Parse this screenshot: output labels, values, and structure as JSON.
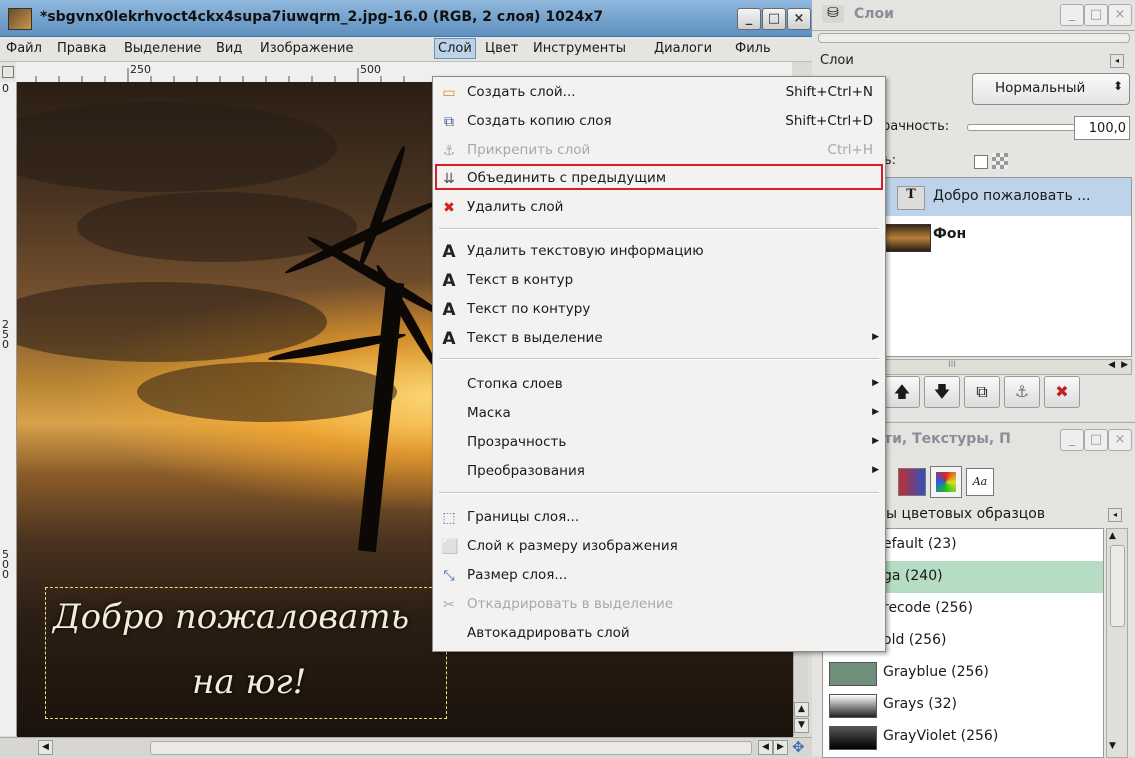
{
  "window": {
    "title": "*sbgvnx0lekrhvoct4ckx4supa7iuwqrm_2.jpg-16.0 (RGB, 2 слоя) 1024x7",
    "min": "_",
    "max": "□",
    "close": "×"
  },
  "menubar": [
    "Файл",
    "Правка",
    "Выделение",
    "Вид",
    "Изображение",
    "Слой",
    "Цвет",
    "Инструменты",
    "Диалоги",
    "Филь"
  ],
  "ruler": {
    "h": [
      "250",
      "500"
    ],
    "v": [
      "0",
      "250",
      "500"
    ]
  },
  "canvas_text": {
    "line1": "Добро пожаловать",
    "line2": "на юг!"
  },
  "layer_menu": {
    "items": [
      {
        "label": "Создать слой...",
        "shortcut": "Shift+Ctrl+N",
        "icon": "new-layer-icon",
        "glyph": "▭"
      },
      {
        "label": "Создать копию слоя",
        "shortcut": "Shift+Ctrl+D",
        "icon": "duplicate-layer-icon",
        "glyph": "⧉"
      },
      {
        "label": "Прикрепить слой",
        "shortcut": "Ctrl+H",
        "icon": "anchor-icon",
        "glyph": "⚓",
        "disabled": true
      },
      {
        "label": "Объединить с предыдущим",
        "shortcut": "",
        "icon": "merge-down-icon",
        "glyph": "⇊"
      },
      {
        "label": "Удалить слой",
        "shortcut": "",
        "icon": "delete-layer-icon",
        "glyph": "✖"
      },
      {
        "label": "Удалить текстовую информацию",
        "icon": "text-icon",
        "glyph": "A"
      },
      {
        "label": "Текст в контур",
        "icon": "text-icon",
        "glyph": "A"
      },
      {
        "label": "Текст по контуру",
        "icon": "text-icon",
        "glyph": "A"
      },
      {
        "label": "Текст в выделение",
        "icon": "text-icon",
        "glyph": "A",
        "submenu": true
      },
      {
        "label": "Стопка слоев",
        "submenu": true
      },
      {
        "label": "Маска",
        "submenu": true
      },
      {
        "label": "Прозрачность",
        "submenu": true
      },
      {
        "label": "Преобразования",
        "submenu": true
      },
      {
        "label": "Границы слоя...",
        "icon": "layer-boundary-icon",
        "glyph": "⬚"
      },
      {
        "label": "Слой к размеру изображения",
        "icon": "layer-to-image-size-icon",
        "glyph": "⬜"
      },
      {
        "label": "Размер слоя...",
        "icon": "scale-layer-icon",
        "glyph": "⤡"
      },
      {
        "label": "Откадрировать в выделение",
        "icon": "crop-icon",
        "glyph": "✂",
        "disabled": true
      },
      {
        "label": "Автокадрировать слой",
        "icon": "",
        "glyph": ""
      }
    ]
  },
  "layers_panel": {
    "title": "Слои",
    "tab_label": "Слои",
    "mode": "Нормальный",
    "opacity_label": "рачность:",
    "opacity_value": "100,0",
    "lock_label": "ь:",
    "layers": [
      {
        "name": "Добро пожаловать ...",
        "type": "text"
      },
      {
        "name": "Фон",
        "type": "image"
      }
    ],
    "scroll_mid": "III"
  },
  "palettes_panel": {
    "title": "ти, Текстуры, П",
    "header": "ы цветовых образцов",
    "items": [
      {
        "label": "efault (23)",
        "color": "#f0f0f0"
      },
      {
        "label": "ga (240)",
        "color": "#dcdcdc"
      },
      {
        "label": "recode (256)",
        "color": "#e8e8e8"
      },
      {
        "label": "old (256)",
        "color": "#f4f4f4"
      },
      {
        "label": "Grayblue (256)",
        "color": "#6f8f7a"
      },
      {
        "label": "Grays (32)",
        "color": "#7a7a7a"
      },
      {
        "label": "GrayViolet (256)",
        "color": "#1c1c1c"
      }
    ]
  },
  "colors": {
    "accent": "#bcd3ea",
    "highlight_border": "#d0202a",
    "palette_selected": "#b7dcc4"
  }
}
